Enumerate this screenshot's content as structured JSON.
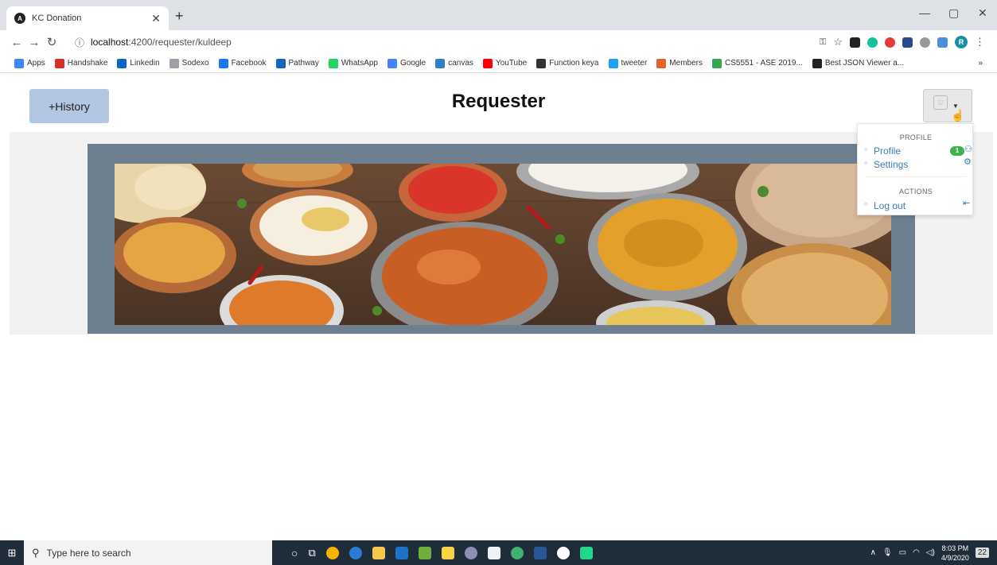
{
  "browser": {
    "tab_title": "KC Donation",
    "url_host": "localhost",
    "url_rest": ":4200/requester/kuldeep",
    "avatar_letter": "R",
    "bookmarks": [
      "Apps",
      "Handshake",
      "Linkedin",
      "Sodexo",
      "Facebook",
      "Pathway",
      "WhatsApp",
      "Google",
      "canvas",
      "YouTube",
      "Function keya",
      "tweeter",
      "Members",
      "CS5551 - ASE 2019...",
      "Best JSON Viewer a..."
    ],
    "bookmark_colors": [
      "#4285f4",
      "#d93025",
      "#0a66c2",
      "#9aa0a6",
      "#1877f2",
      "#1565c0",
      "#25d366",
      "#4285f4",
      "#2f7fd1",
      "#ff0000",
      "#333333",
      "#1da1f2",
      "#e8622a",
      "#34a853",
      "#222222"
    ],
    "more_bookmarks": "»"
  },
  "header": {
    "history_label": "+History",
    "title": "Requester"
  },
  "dropdown": {
    "profile_header": "PROFILE",
    "profile_item": "Profile",
    "profile_badge": "1",
    "settings_item": "Settings",
    "actions_header": "ACTIONS",
    "logout_item": "Log out"
  },
  "taskbar": {
    "search_placeholder": "Type here to search",
    "time": "8:03 PM",
    "date": "4/9/2020",
    "notification_count": "22"
  },
  "colors": {
    "history_button": "#b4c7e2",
    "banner_frame": "#6e7f90",
    "link": "#3a7ab7",
    "badge": "#3fb34f"
  }
}
